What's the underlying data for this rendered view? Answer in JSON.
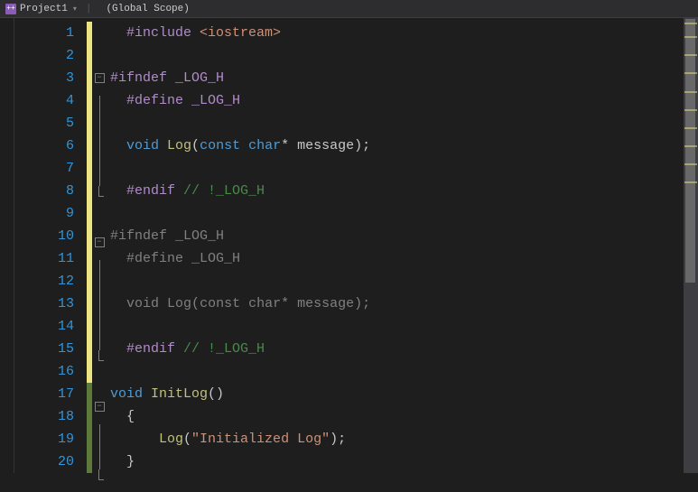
{
  "breadcrumb": {
    "project": "Project1",
    "scope": "(Global Scope)"
  },
  "gutter": {
    "lines": [
      "1",
      "2",
      "3",
      "4",
      "5",
      "6",
      "7",
      "8",
      "9",
      "10",
      "11",
      "12",
      "13",
      "14",
      "15",
      "16",
      "17",
      "18",
      "19",
      "20"
    ]
  },
  "fold": {
    "rows": [
      "",
      "",
      "box",
      "line",
      "line",
      "line",
      "line",
      "end",
      "",
      "box",
      "line",
      "line",
      "line",
      "line",
      "end",
      "",
      "box",
      "line",
      "line",
      "end"
    ]
  },
  "changes": {
    "rows": [
      "yellow",
      "yellow",
      "yellow",
      "yellow",
      "yellow",
      "yellow",
      "yellow",
      "yellow",
      "yellow",
      "yellow",
      "yellow",
      "yellow",
      "yellow",
      "yellow",
      "yellow",
      "yellow",
      "green",
      "green",
      "green",
      "green"
    ]
  },
  "code": {
    "l1": {
      "pp": "#include ",
      "inc": "<iostream>"
    },
    "l3": {
      "pp": "#ifndef ",
      "m": "_LOG_H"
    },
    "l4": {
      "pp": "#define ",
      "m": "_LOG_H"
    },
    "l6": {
      "kw1": "void ",
      "fn": "Log",
      "p1": "(",
      "kw2": "const ",
      "ty": "char",
      "p2": "* ",
      "id": "message",
      "p3": ");"
    },
    "l8": {
      "pp": "#endif ",
      "c": "// !_LOG_H"
    },
    "l10": {
      "pp": "#ifndef ",
      "m": "_LOG_H"
    },
    "l11": {
      "pp": "#define ",
      "m": "_LOG_H"
    },
    "l13": {
      "kw1": "void ",
      "fn": "Log",
      "p1": "(",
      "kw2": "const ",
      "ty": "char",
      "p2": "* ",
      "id": "message",
      "p3": ");"
    },
    "l15": {
      "pp": "#endif ",
      "c": "// !_LOG_H"
    },
    "l17": {
      "kw": "void ",
      "fn": "InitLog",
      "p": "()"
    },
    "l18": {
      "p": "{"
    },
    "l19": {
      "fn": "Log",
      "p1": "(",
      "s": "\"Initialized Log\"",
      "p2": ");"
    },
    "l20": {
      "p": "}"
    }
  }
}
